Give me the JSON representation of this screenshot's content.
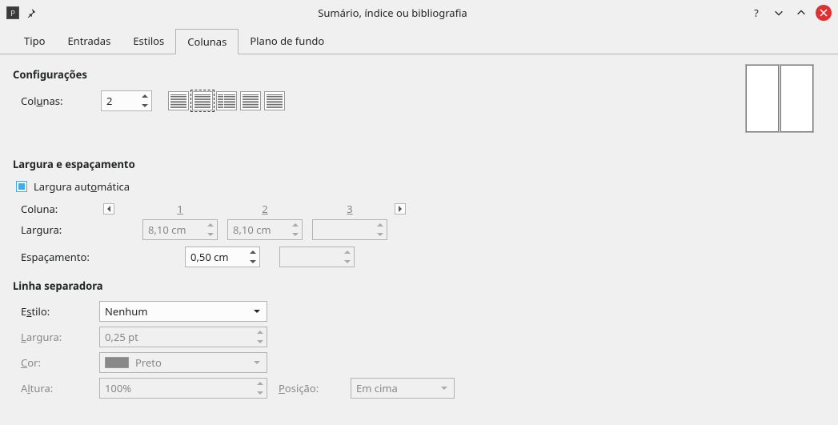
{
  "titlebar": {
    "title": "Sumário, índice ou bibliografia"
  },
  "tabs": {
    "tipo": "Tipo",
    "entradas": "Entradas",
    "estilos": "Estilos",
    "colunas": "Colunas",
    "plano_de_fundo": "Plano de fundo"
  },
  "sections": {
    "configuracoes": "Configurações",
    "largura_espac": "Largura e espaçamento",
    "linha_sep": "Linha separadora"
  },
  "labels": {
    "colunas_pre": "Col",
    "colunas_u": "u",
    "colunas_post": "nas:",
    "largura_auto_pre": "Largura aut",
    "largura_auto_u": "o",
    "largura_auto_post": "mática",
    "coluna": "Coluna:",
    "largura": "Largura:",
    "espacamento": "Espaçamento:",
    "estilo_pre": "E",
    "estilo_u": "s",
    "estilo_post": "tilo:",
    "sep_largura_u": "L",
    "sep_largura_post": "argura:",
    "cor_u": "C",
    "cor_post": "or:",
    "altura_pre": "A",
    "altura_u": "l",
    "altura_post": "tura:",
    "posicao_u": "P",
    "posicao_post": "osição:"
  },
  "values": {
    "colunas": "2",
    "col_nums": {
      "c1": "1",
      "c2": "2",
      "c3": "3"
    },
    "largura1": "8,10 cm",
    "largura2": "8,10 cm",
    "largura3": "",
    "espac1": "0,50 cm",
    "espac2": "",
    "estilo": "Nenhum",
    "sep_largura": "0,25 pt",
    "cor": "Preto",
    "altura": "100%",
    "posicao": "Em cima"
  }
}
